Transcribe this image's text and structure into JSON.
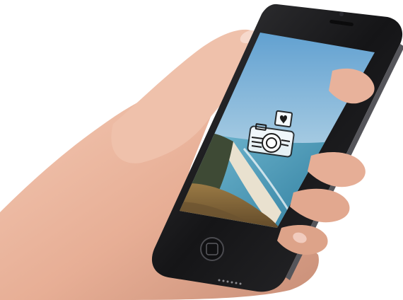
{
  "scene": {
    "subject": "hand-holding-smartphone",
    "device_color": "#1c1c1e",
    "skin_color": "#e9b49e"
  },
  "screen": {
    "wallpaper": "coastal-beach-from-cliff",
    "sky_top_color": "#5f9fd0",
    "sky_bottom_color": "#cfe3ef",
    "ocean_color": "#4f9db8",
    "grass_color": "#8a6a3c",
    "overlay_icon": "camera-with-heart-icon"
  },
  "hardware": {
    "home_button": "home-button",
    "earpiece": "earpiece-speaker",
    "front_camera": "front-camera"
  }
}
